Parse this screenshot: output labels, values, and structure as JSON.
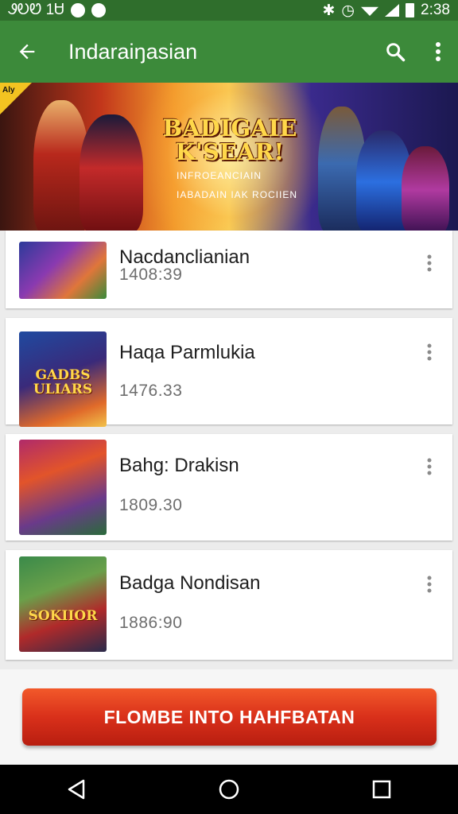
{
  "status_bar": {
    "left_text": "ᏭᎧᏬ 1Ꮜ",
    "time": "2:38"
  },
  "app_bar": {
    "title": "Indaraiŋasian",
    "back_icon": "arrow-back-icon",
    "search_icon": "search-icon",
    "more_icon": "more-vert-icon"
  },
  "banner": {
    "badge": "Aly",
    "title_line1": "BADIGAIE",
    "title_line2": "K'SEAR!",
    "subtitle_line1": "INFROEANCIAIN",
    "subtitle_line2": "IABADAIN IAK ROCIIEN"
  },
  "items": [
    {
      "title": "Nacdanclianian",
      "value": "1408:39",
      "thumb_label": ""
    },
    {
      "title": "Haqa Parmlukia",
      "value": "1476.33",
      "thumb_label": "GADBS ULIARS"
    },
    {
      "title": "Bahg: Drakisn",
      "value": "1809.30",
      "thumb_label": ""
    },
    {
      "title": "Badga Nondisan",
      "value": "1886:90",
      "thumb_label": "SOKIIOR"
    }
  ],
  "cta": {
    "label": "FLOMBE INTO HAHFBATAN"
  },
  "nav": {
    "back_icon": "nav-back-icon",
    "home_icon": "nav-home-icon",
    "recents_icon": "nav-recents-icon"
  },
  "colors": {
    "status_bar": "#2f6e2c",
    "app_bar": "#3c8a3a",
    "cta_top": "#f2592a",
    "cta_bottom": "#b81e10"
  }
}
